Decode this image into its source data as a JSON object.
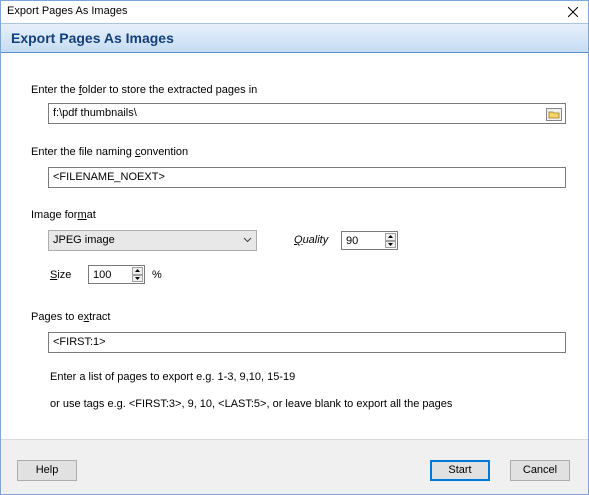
{
  "window": {
    "title": "Export Pages As Images"
  },
  "header": {
    "title": "Export Pages As Images"
  },
  "folder": {
    "label_pre": "Enter the ",
    "label_u": "f",
    "label_post": "older to store the extracted pages in",
    "value": "f:\\pdf thumbnails\\"
  },
  "naming": {
    "label_pre": "Enter the file naming ",
    "label_u": "c",
    "label_post": "onvention",
    "value": "<FILENAME_NOEXT>"
  },
  "format": {
    "label_pre": "Image for",
    "label_u": "m",
    "label_post": "at",
    "selected": "JPEG image",
    "quality_label_u": "Q",
    "quality_label_post": "uality",
    "quality_value": "90",
    "size_label_u": "S",
    "size_label_post": "ize",
    "size_value": "100",
    "size_unit": "%"
  },
  "pages": {
    "label_pre": "Pages to e",
    "label_u": "x",
    "label_post": "tract",
    "value": "<FIRST:1>",
    "hint1": "Enter a list of pages to export e.g. 1-3, 9,10, 15-19",
    "hint2": "or use tags e.g. <FIRST:3>, 9, 10, <LAST:5>, or leave blank to export all the pages"
  },
  "buttons": {
    "help": "Help",
    "start": "Start",
    "cancel": "Cancel"
  },
  "colors": {
    "header_text": "#14407a",
    "header_gradient_top": "#e7f0fb",
    "header_gradient_bottom": "#c6dcf3",
    "accent": "#0078d7"
  }
}
